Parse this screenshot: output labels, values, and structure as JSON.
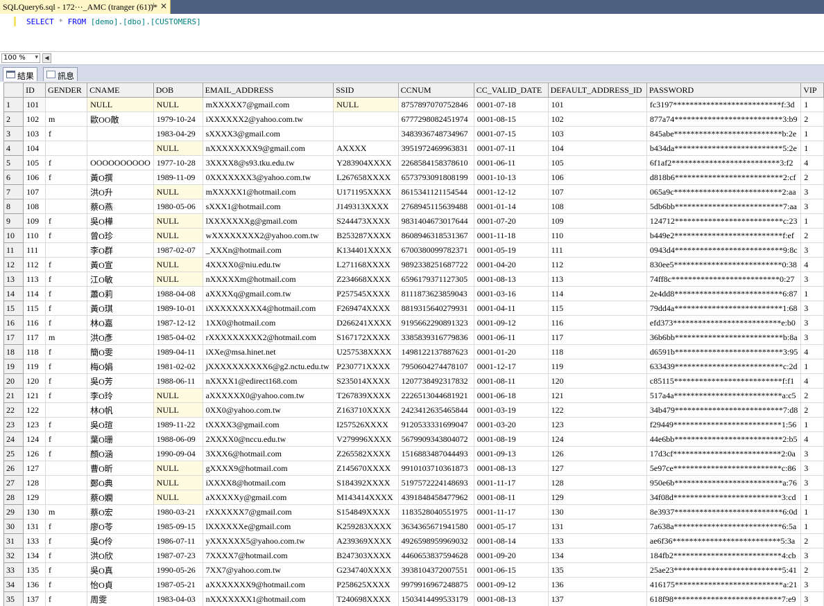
{
  "window": {
    "tab_title": "SQLQuery6.sql - 172···_AMC (tranger (61))*",
    "pin_glyph": "⊣",
    "close_glyph": "✕"
  },
  "editor": {
    "kw_select": "SELECT",
    "star": "*",
    "kw_from": "FROM",
    "table_ref": "[demo].[dbo].[CUSTOMERS]"
  },
  "zoom": {
    "value": "100 %",
    "dropdown_glyph": "▾",
    "scroll_left_glyph": "◀"
  },
  "result_tabs": [
    {
      "label": "結果",
      "icon": "grid-icon"
    },
    {
      "label": "訊息",
      "icon": "message-icon"
    }
  ],
  "grid": {
    "columns": [
      "ID",
      "GENDER",
      "CNAME",
      "DOB",
      "EMAIL_ADDRESS",
      "SSID",
      "CCNUM",
      "CC_VALID_DATE",
      "DEFAULT_ADDRESS_ID",
      "PASSWORD",
      "VIP"
    ],
    "rows": [
      [
        "101",
        "",
        "NULL",
        "NULL",
        "mXXXXX7@gmail.com",
        "NULL",
        "8757897070752846",
        "0001-07-18",
        "101",
        "fc3197**************************f:3d",
        "1"
      ],
      [
        "102",
        "m",
        "歐OO敵",
        "1979-10-24",
        "iXXXXXX2@yahoo.com.tw",
        "",
        "6777298082451974",
        "0001-08-15",
        "102",
        "877a74**************************3:b9",
        "2"
      ],
      [
        "103",
        "f",
        "",
        "1983-04-29",
        "sXXXX3@gmail.com",
        "",
        "3483936748734967",
        "0001-07-15",
        "103",
        "845abe**************************b:2e",
        "1"
      ],
      [
        "104",
        "",
        "",
        "NULL",
        "nXXXXXXXX9@gmail.com",
        "AXXXX",
        "3951972469963831",
        "0001-07-11",
        "104",
        "b434da**************************5:2e",
        "1"
      ],
      [
        "105",
        "f",
        "OOOOOOOOOO",
        "1977-10-28",
        "3XXXX8@s93.tku.edu.tw",
        "Y283904XXXX",
        "2268584158378610",
        "0001-06-11",
        "105",
        "6f1af2**************************3:f2",
        "4"
      ],
      [
        "106",
        "f",
        "黃O撰",
        "1989-11-09",
        "0XXXXXXX3@yahoo.com.tw",
        "L267658XXXX",
        "6573793091808199",
        "0001-10-13",
        "106",
        "d818b6**************************2:cf",
        "2"
      ],
      [
        "107",
        "",
        "洪O升",
        "NULL",
        "mXXXXX1@hotmail.com",
        "U171195XXXX",
        "8615341121154544",
        "0001-12-12",
        "107",
        "065a9c**************************2:aa",
        "3"
      ],
      [
        "108",
        "",
        "蔡O燕",
        "1980-05-06",
        "sXXX1@hotmail.com",
        "J149313XXXX",
        "2768945115639488",
        "0001-01-14",
        "108",
        "5db6bb**************************7:aa",
        "3"
      ],
      [
        "109",
        "f",
        "吳O樺",
        "NULL",
        "lXXXXXXXg@gmail.com",
        "S244473XXXX",
        "9831404673017644",
        "0001-07-20",
        "109",
        "124712**************************c:23",
        "1"
      ],
      [
        "110",
        "f",
        "曾O珍",
        "NULL",
        "wXXXXXXXX2@yahoo.com.tw",
        "B253287XXXX",
        "8608946318531367",
        "0001-11-18",
        "110",
        "b449e2**************************f:ef",
        "2"
      ],
      [
        "111",
        "",
        "李O群",
        "1987-02-07",
        "_XXXn@hotmail.com",
        "K134401XXXX",
        "6700380099782371",
        "0001-05-19",
        "111",
        "0943d4**************************9:8c",
        "3"
      ],
      [
        "112",
        "f",
        "黃O宣",
        "NULL",
        "4XXXX0@niu.edu.tw",
        "L271168XXXX",
        "9892338251687722",
        "0001-04-20",
        "112",
        "830ee5**************************0:38",
        "4"
      ],
      [
        "113",
        "f",
        "江O敏",
        "NULL",
        "nXXXXXm@hotmail.com",
        "Z234668XXXX",
        "6596179371127305",
        "0001-08-13",
        "113",
        "74ff8c**************************0:27",
        "3"
      ],
      [
        "114",
        "f",
        "蕭O莉",
        "1988-04-08",
        "aXXXXq@gmail.com.tw",
        "P257545XXXX",
        "8111873623859043",
        "0001-03-16",
        "114",
        "2e4dd8**************************6:87",
        "1"
      ],
      [
        "115",
        "f",
        "黃O琪",
        "1989-10-01",
        "iXXXXXXXXX4@hotmail.com",
        "F269474XXXX",
        "8819315640279931",
        "0001-04-11",
        "115",
        "79dd4a**************************1:68",
        "3"
      ],
      [
        "116",
        "f",
        "林O嘉",
        "1987-12-12",
        "1XX0@hotmail.com",
        "D266241XXXX",
        "9195662290891323",
        "0001-09-12",
        "116",
        "efd373**************************e:b0",
        "3"
      ],
      [
        "117",
        "m",
        "洪O彥",
        "1985-04-02",
        "rXXXXXXXXX2@hotmail.com",
        "S167172XXXX",
        "3385839316779836",
        "0001-06-11",
        "117",
        "36b6bb**************************b:8a",
        "3"
      ],
      [
        "118",
        "f",
        "簡O雯",
        "1989-04-11",
        "iXXe@msa.hinet.net",
        "U257538XXXX",
        "1498122137887623",
        "0001-01-20",
        "118",
        "d6591b**************************3:95",
        "4"
      ],
      [
        "119",
        "f",
        "梅O娟",
        "1981-02-02",
        "jXXXXXXXXXX6@g2.nctu.edu.tw",
        "P230771XXXX",
        "7950604274478107",
        "0001-12-17",
        "119",
        "633439**************************c:2d",
        "1"
      ],
      [
        "120",
        "f",
        "吳O芳",
        "1988-06-11",
        "nXXXX1@edirect168.com",
        "S235014XXXX",
        "1207738492317832",
        "0001-08-11",
        "120",
        "c85115**************************f:f1",
        "4"
      ],
      [
        "121",
        "f",
        "李O玲",
        "NULL",
        "aXXXXXX0@yahoo.com.tw",
        "T267839XXXX",
        "2226513044681921",
        "0001-06-18",
        "121",
        "517a4a**************************a:c5",
        "2"
      ],
      [
        "122",
        "",
        "林O帆",
        "NULL",
        "0XX0@yahoo.com.tw",
        "Z163710XXXX",
        "2423412635465844",
        "0001-03-19",
        "122",
        "34b479**************************7:d8",
        "2"
      ],
      [
        "123",
        "f",
        "吳O瑄",
        "1989-11-22",
        "tXXXX3@gmail.com",
        "I257526XXXX",
        "9120533331699047",
        "0001-03-20",
        "123",
        "f29449**************************1:56",
        "1"
      ],
      [
        "124",
        "f",
        "葉O珊",
        "1988-06-09",
        "2XXXX0@nccu.edu.tw",
        "V279996XXXX",
        "5679909343804072",
        "0001-08-19",
        "124",
        "44e6bb**************************2:b5",
        "4"
      ],
      [
        "126",
        "f",
        "顏O涵",
        "1990-09-04",
        "3XXX6@hotmail.com",
        "Z265582XXXX",
        "1516883487044493",
        "0001-09-13",
        "126",
        "17d3cf**************************2:0a",
        "3"
      ],
      [
        "127",
        "",
        "曹O昕",
        "NULL",
        "gXXXX9@hotmail.com",
        "Z145670XXXX",
        "9910103710361873",
        "0001-08-13",
        "127",
        "5e97ce**************************c:86",
        "3"
      ],
      [
        "128",
        "",
        "鄭O典",
        "NULL",
        "iXXXX8@hotmail.com",
        "S184392XXXX",
        "5197572224148693",
        "0001-11-17",
        "128",
        "950e6b**************************a:76",
        "3"
      ],
      [
        "129",
        "",
        "蔡O嫻",
        "NULL",
        "aXXXXXy@gmail.com",
        "M143414XXXX",
        "4391848458477962",
        "0001-08-11",
        "129",
        "34f08d**************************3:cd",
        "1"
      ],
      [
        "130",
        "m",
        "蔡O宏",
        "1980-03-21",
        "rXXXXXX7@gmail.com",
        "S154849XXXX",
        "1183528040551975",
        "0001-11-17",
        "130",
        "8e3937**************************6:0d",
        "1"
      ],
      [
        "131",
        "f",
        "廖O苓",
        "1985-09-15",
        "lXXXXXXe@gmail.com",
        "K259283XXXX",
        "3634365671941580",
        "0001-05-17",
        "131",
        "7a638a**************************6:5a",
        "1"
      ],
      [
        "133",
        "f",
        "吳O伶",
        "1986-07-11",
        "yXXXXXX5@yahoo.com.tw",
        "A239369XXXX",
        "4926598959969032",
        "0001-08-14",
        "133",
        "ae6f36**************************5:3a",
        "2"
      ],
      [
        "134",
        "f",
        "洪O欣",
        "1987-07-23",
        "7XXXX7@hotmail.com",
        "B247303XXXX",
        "4460653837594628",
        "0001-09-20",
        "134",
        "184fb2**************************4:cb",
        "3"
      ],
      [
        "135",
        "f",
        "吳O真",
        "1990-05-26",
        "7XX7@yahoo.com.tw",
        "G234740XXXX",
        "3938104372007551",
        "0001-06-15",
        "135",
        "25ae23**************************5:41",
        "2"
      ],
      [
        "136",
        "f",
        "怡O貞",
        "1987-05-21",
        "aXXXXXXX9@hotmail.com",
        "P258625XXXX",
        "9979916967248875",
        "0001-09-12",
        "136",
        "416175**************************a:21",
        "3"
      ],
      [
        "137",
        "f",
        "周雯",
        "1983-04-03",
        "nXXXXXXX1@hotmail.com",
        "T240698XXXX",
        "1503414499533179",
        "0001-08-13",
        "137",
        "618f98**************************7:e9",
        "3"
      ]
    ]
  }
}
